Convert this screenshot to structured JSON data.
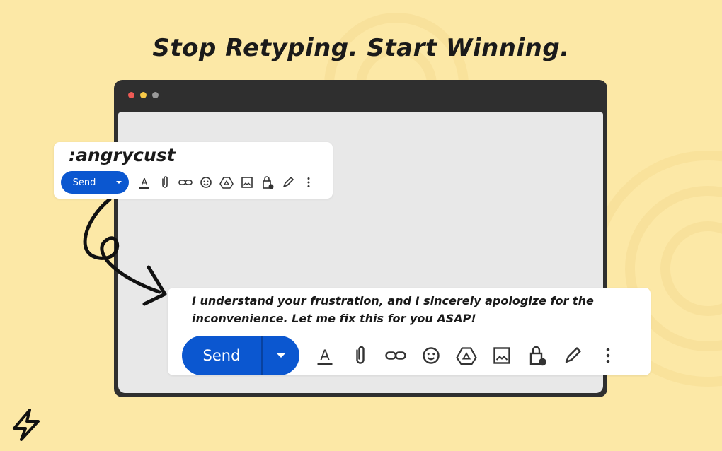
{
  "headline": "Stop Retyping. Start Winning.",
  "window": {
    "dots": [
      "red",
      "yellow",
      "gray"
    ]
  },
  "shortcut_card": {
    "shortcut_text": ":angrycust",
    "send_label": "Send"
  },
  "reply_card": {
    "text": "I understand your frustration, and I sincerely apologize for the inconvenience. Let me fix this for you ASAP!",
    "send_label": "Send"
  },
  "toolbar_icons": [
    "text-format-icon",
    "attach-icon",
    "link-icon",
    "emoji-icon",
    "drive-icon",
    "photo-icon",
    "confidential-lock-icon",
    "signature-pen-icon",
    "more-options-icon"
  ],
  "colors": {
    "background": "#fce8a6",
    "send_button": "#0b57d0",
    "window_frame": "#2f2f2f",
    "window_body": "#e8e8e8"
  },
  "logo_icon": "lightning-bolt-icon"
}
